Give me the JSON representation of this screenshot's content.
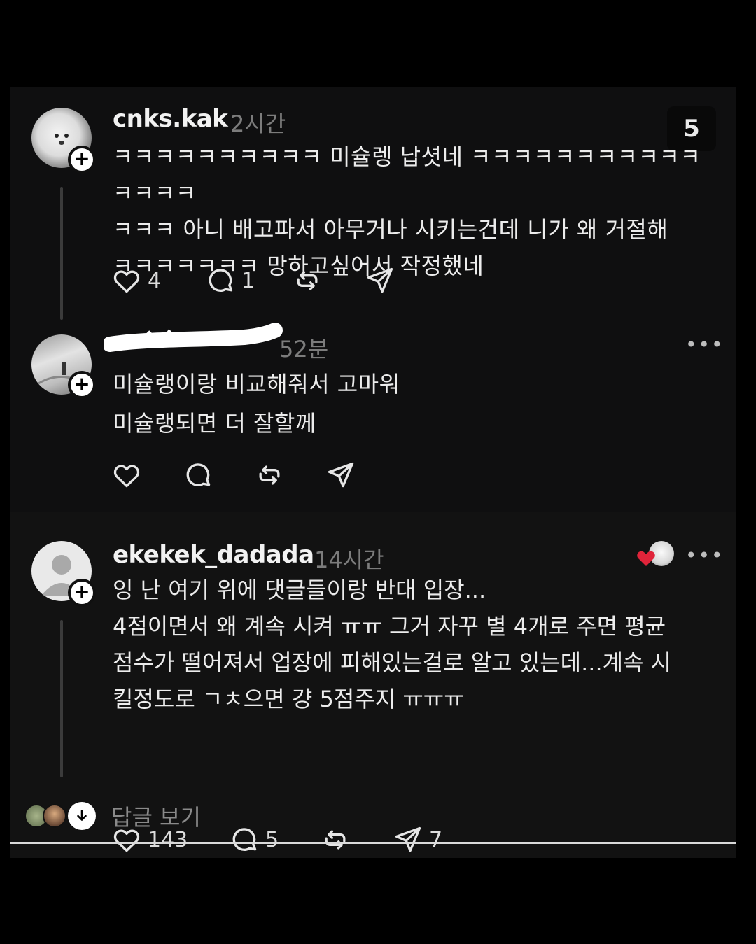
{
  "comments": [
    {
      "username": "cnks.kak",
      "time": "2시간",
      "text": "ㅋㅋㅋㅋㅋㅋㅋㅋㅋㅋ 미슐렝 납셧네 ㅋㅋㅋㅋㅋㅋㅋㅋㅋㅋㅋㅋㅋㅋㅋ\nㅋㅋㅋ 아니 배고파서 아무거나 시키는건데 니가 왜 거절해\nㅋㅋㅋㅋㅋㅋㅋ 망하고싶어서 작정했네",
      "likes": "4",
      "replies": "1",
      "views_badge": "5"
    },
    {
      "username": "",
      "time": "52분",
      "text": "미슐랭이랑 비교해줘서 고마워\n미슐랭되면 더 잘할께"
    },
    {
      "username": "ekekek_dadada",
      "time": "14시간",
      "text": "잉 난 여기 위에 댓글들이랑 반대 입장...\n4점이면서 왜 계속 시켜 ㅠㅠ 그거 자꾸 별 4개로 주면 평균\n점수가 떨어져서 업장에 피해있는걸로 알고 있는데...계속 시\n킬정도로 ㄱㅊ으면 걍 5점주지 ㅠㅠㅠ",
      "likes": "143",
      "replies": "5",
      "shares": "7"
    }
  ],
  "more_label": "•••",
  "view_replies_label": "답글 보기",
  "colors": {
    "background": "#000000",
    "panel": "#101010",
    "text": "#ececec",
    "muted": "#7c7c7c",
    "heart_red": "#e0243a"
  },
  "icons": [
    "heart-icon",
    "comment-icon",
    "repost-icon",
    "share-icon",
    "plus-icon",
    "more-icon",
    "arrow-down-icon"
  ]
}
